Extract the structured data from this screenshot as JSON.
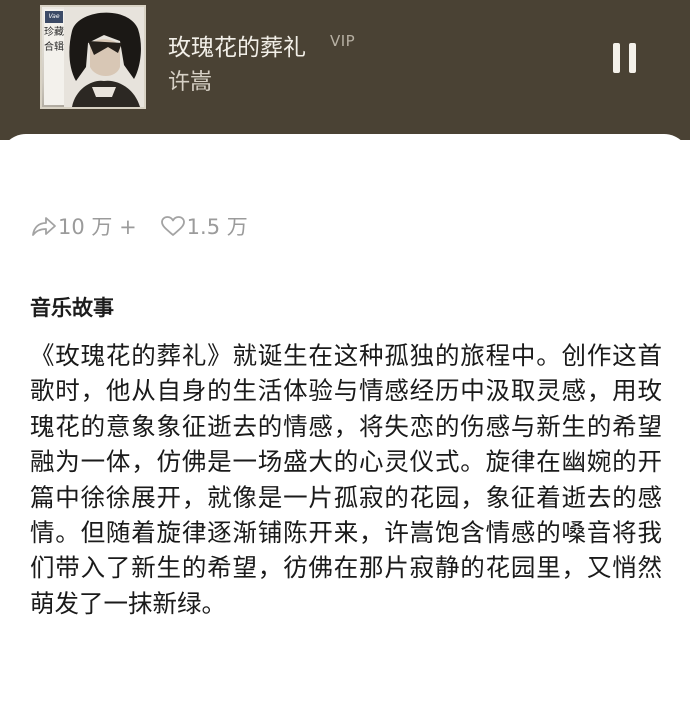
{
  "player": {
    "song_title": "玫瑰花的葬礼",
    "vip_label": "VIP",
    "artist": "许嵩",
    "album_art": {
      "badge": "Vae",
      "vertical_text": "珍藏合辑"
    },
    "play_state": "paused",
    "pause_icon": "pause-icon"
  },
  "stats": {
    "shares": "10 万 +",
    "likes": "1.5 万",
    "share_icon": "share-icon",
    "like_icon": "heart-icon"
  },
  "story": {
    "heading": "音乐故事",
    "body": "《玫瑰花的葬礼》就诞生在这种孤独的旅程中。创作这首歌时，他从自身的生活体验与情感经历中汲取灵感，用玫瑰花的意象象征逝去的情感，将失恋的伤感与新生的希望融为一体，仿佛是一场盛大的心灵仪式。旋律在幽婉的开篇中徐徐展开，就像是一片孤寂的花园，象征着逝去的感情。但随着旋律逐渐铺陈开来，许嵩饱含情感的嗓音将我们带入了新生的希望，彷佛在那片寂静的花园里，又悄然萌发了一抹新绿。"
  },
  "colors": {
    "player_background": "#4a4234",
    "title_text": "#f2efe8",
    "muted_text": "#9b9b9b"
  }
}
